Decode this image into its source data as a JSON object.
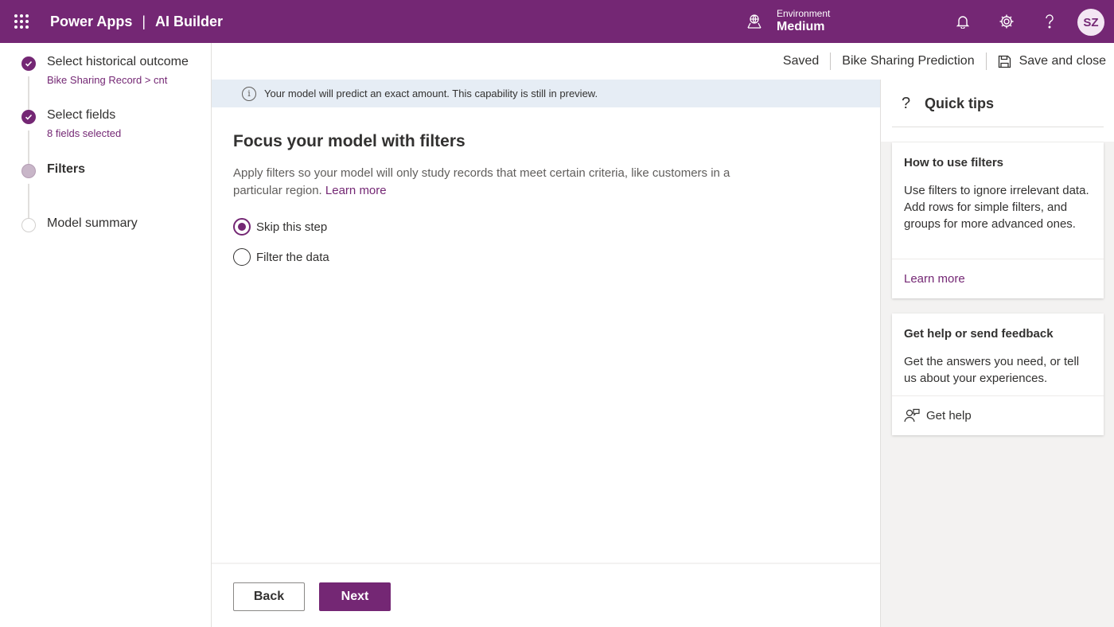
{
  "topbar": {
    "app_name": "Power Apps",
    "separator": "|",
    "product": "AI Builder",
    "environment_label": "Environment",
    "environment_value": "Medium",
    "user_initials": "SZ",
    "brand_color": "#742774"
  },
  "stepper": {
    "steps": [
      {
        "title": "Select historical outcome",
        "subtitle": "Bike Sharing Record > cnt",
        "state": "done"
      },
      {
        "title": "Select fields",
        "subtitle": "8 fields selected",
        "state": "done"
      },
      {
        "title": "Filters",
        "subtitle": "",
        "state": "current"
      },
      {
        "title": "Model summary",
        "subtitle": "",
        "state": "todo"
      }
    ]
  },
  "commandbar": {
    "status": "Saved",
    "model_name": "Bike Sharing Prediction",
    "save_close_label": "Save and close"
  },
  "banner": {
    "text": "Your model will predict an exact amount. This capability is still in preview."
  },
  "main": {
    "title": "Focus your model with filters",
    "description": "Apply filters so your model will only study records that meet certain criteria, like customers in a particular region.",
    "learn_more": "Learn more",
    "options": [
      {
        "label": "Skip this step",
        "checked": true
      },
      {
        "label": "Filter the data",
        "checked": false
      }
    ]
  },
  "footer": {
    "back_label": "Back",
    "next_label": "Next"
  },
  "tips": {
    "title": "Quick tips",
    "cards": [
      {
        "title": "How to use filters",
        "body": "Use filters to ignore irrelevant data. Add rows for simple filters, and groups for more advanced ones.",
        "link": "Learn more"
      },
      {
        "title": "Get help or send feedback",
        "body": "Get the answers you need, or tell us about your experiences.",
        "link": "Get help"
      }
    ]
  }
}
